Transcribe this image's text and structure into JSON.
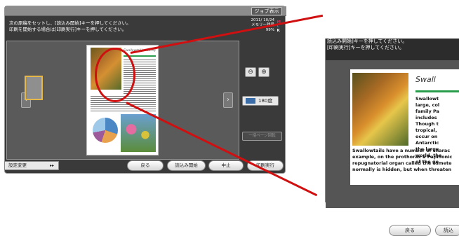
{
  "header": {
    "job_button": "ジョブ表示"
  },
  "message": {
    "line1": "次の原稿をセットし、[読込み開始]キーを押してください。",
    "line2": "印刷を開始する場合は[印刷実行]キーを押してください。"
  },
  "status": {
    "datetime": "2011/ 10/24  ",
    "memory_label": "メモリー残量",
    "memory_value": "99%",
    "toner_letters": [
      "M",
      "C",
      "K"
    ],
    "toner_colors": [
      "#d0305a",
      "#2a8ad0",
      "#ffffff"
    ]
  },
  "preview": {
    "doc_title": "Swallowtail butterfly",
    "rotate_label": "180度",
    "page_rotate_label": "一括ページ回転"
  },
  "buttons": {
    "settings": "設定変更",
    "back": "戻る",
    "start_read": "読込み開始",
    "stop": "中止",
    "print": "印刷実行"
  },
  "zoomed": {
    "msg1": "読込み開始]キーを押してください。",
    "msg2": "[印刷実行]キーを押してください。",
    "title": "Swall",
    "right_text": "Swallowt\nlarge, col\nfamily Pa\nincludes\nThough t\ntropical,\noccur on\nAntarctic\nthe large\nworld, the\nof the ge",
    "bottom_text": "Swallowtails have a number of charac\nexample, on the prothorax a Papilionic\nrepugnatorial organ called the osmete\nnormally is hidden, but when threaten",
    "back": "戻る",
    "read": "読込"
  }
}
